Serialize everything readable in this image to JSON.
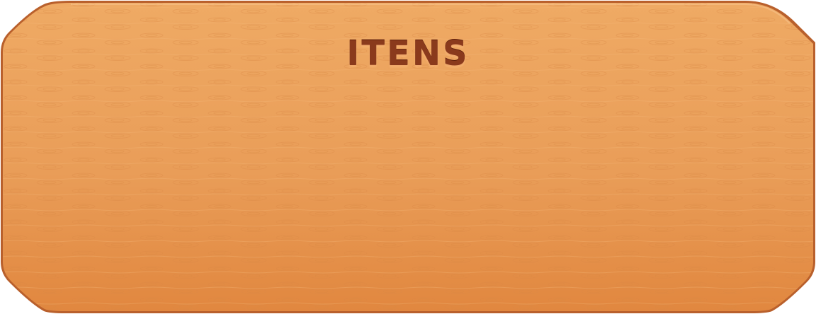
{
  "panel": {
    "title": "ITENS"
  },
  "colors": {
    "wood_light": "#eda55e",
    "wood_dark": "#e28a45",
    "border": "#b9602c",
    "title": "#8a3a1c"
  }
}
